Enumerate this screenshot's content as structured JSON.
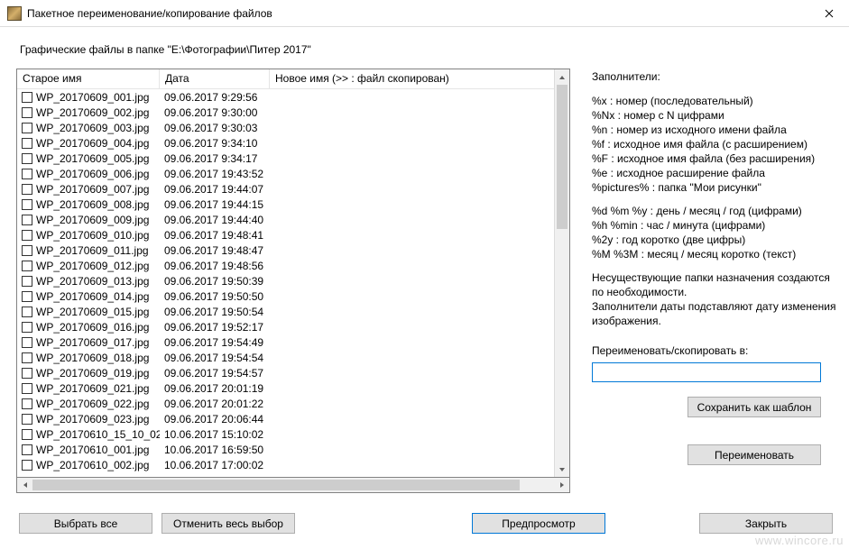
{
  "titlebar": {
    "title": "Пакетное переименование/копирование файлов"
  },
  "path_label": "Графические файлы в папке \"E:\\Фотографии\\Питер 2017\"",
  "table": {
    "headers": {
      "old": "Старое имя",
      "date": "Дата",
      "new": "Новое имя (>> : файл скопирован)"
    },
    "rows": [
      {
        "old": "WP_20170609_001.jpg",
        "date": "09.06.2017 9:29:56"
      },
      {
        "old": "WP_20170609_002.jpg",
        "date": "09.06.2017 9:30:00"
      },
      {
        "old": "WP_20170609_003.jpg",
        "date": "09.06.2017 9:30:03"
      },
      {
        "old": "WP_20170609_004.jpg",
        "date": "09.06.2017 9:34:10"
      },
      {
        "old": "WP_20170609_005.jpg",
        "date": "09.06.2017 9:34:17"
      },
      {
        "old": "WP_20170609_006.jpg",
        "date": "09.06.2017 19:43:52"
      },
      {
        "old": "WP_20170609_007.jpg",
        "date": "09.06.2017 19:44:07"
      },
      {
        "old": "WP_20170609_008.jpg",
        "date": "09.06.2017 19:44:15"
      },
      {
        "old": "WP_20170609_009.jpg",
        "date": "09.06.2017 19:44:40"
      },
      {
        "old": "WP_20170609_010.jpg",
        "date": "09.06.2017 19:48:41"
      },
      {
        "old": "WP_20170609_011.jpg",
        "date": "09.06.2017 19:48:47"
      },
      {
        "old": "WP_20170609_012.jpg",
        "date": "09.06.2017 19:48:56"
      },
      {
        "old": "WP_20170609_013.jpg",
        "date": "09.06.2017 19:50:39"
      },
      {
        "old": "WP_20170609_014.jpg",
        "date": "09.06.2017 19:50:50"
      },
      {
        "old": "WP_20170609_015.jpg",
        "date": "09.06.2017 19:50:54"
      },
      {
        "old": "WP_20170609_016.jpg",
        "date": "09.06.2017 19:52:17"
      },
      {
        "old": "WP_20170609_017.jpg",
        "date": "09.06.2017 19:54:49"
      },
      {
        "old": "WP_20170609_018.jpg",
        "date": "09.06.2017 19:54:54"
      },
      {
        "old": "WP_20170609_019.jpg",
        "date": "09.06.2017 19:54:57"
      },
      {
        "old": "WP_20170609_021.jpg",
        "date": "09.06.2017 20:01:19"
      },
      {
        "old": "WP_20170609_022.jpg",
        "date": "09.06.2017 20:01:22"
      },
      {
        "old": "WP_20170609_023.jpg",
        "date": "09.06.2017 20:06:44"
      },
      {
        "old": "WP_20170610_15_10_02...",
        "date": "10.06.2017 15:10:02"
      },
      {
        "old": "WP_20170610_001.jpg",
        "date": "10.06.2017 16:59:50"
      },
      {
        "old": "WP_20170610_002.jpg",
        "date": "10.06.2017 17:00:02"
      }
    ]
  },
  "placeholders": {
    "title": "Заполнители:",
    "group1": [
      "%x : номер (последовательный)",
      "%Nx : номер с N цифрами",
      "%n : номер из исходного имени файла",
      "%f : исходное имя файла (с расширением)",
      "%F : исходное имя файла (без расширения)",
      "%e : исходное расширение файла",
      "%pictures% : папка \"Мои рисунки\""
    ],
    "group2": [
      "%d %m %y : день / месяц / год (цифрами)",
      "%h %min : час / минута (цифрами)",
      "%2y : год коротко (две цифры)",
      "%M %3M : месяц / месяц коротко (текст)"
    ],
    "note": [
      "Несуществующие папки назначения создаются",
      "по необходимости.",
      "Заполнители даты подставляют дату изменения",
      "изображения."
    ]
  },
  "rename": {
    "label": "Переименовать/скопировать в:",
    "value": ""
  },
  "buttons": {
    "save_template": "Сохранить как шаблон",
    "rename": "Переименовать",
    "select_all": "Выбрать все",
    "deselect_all": "Отменить весь выбор",
    "preview": "Предпросмотр",
    "close": "Закрыть"
  },
  "watermark": "www.wincore.ru"
}
